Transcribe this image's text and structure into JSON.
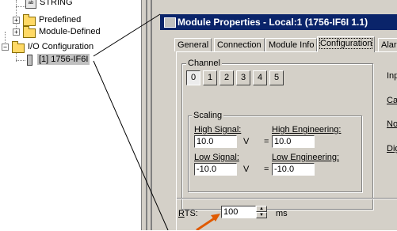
{
  "tree": {
    "items": [
      {
        "label": "STRING",
        "icon": "data-type-icon"
      },
      {
        "label": "Predefined",
        "icon": "data-type-folder-icon",
        "expander": "+"
      },
      {
        "label": "Module-Defined",
        "icon": "data-type-folder-icon",
        "expander": "+"
      },
      {
        "label": "I/O Configuration",
        "icon": "folder-icon",
        "expander": "−"
      },
      {
        "label": "[1] 1756-IF6I",
        "icon": "module-icon"
      }
    ]
  },
  "dialog": {
    "title": "Module Properties - Local:1 (1756-IF6I 1.1)",
    "tabs": [
      "General",
      "Connection",
      "Module Info",
      "Configuration",
      "Alarm"
    ],
    "active_tab": "Configuration",
    "channel": {
      "label": "Channel",
      "buttons": [
        "0",
        "1",
        "2",
        "3",
        "4",
        "5"
      ],
      "selected": "0"
    },
    "scaling": {
      "label": "Scaling",
      "high_signal_label": "High Signal:",
      "high_signal_value": "10.0",
      "high_signal_unit": "V",
      "high_eng_label": "High Engineering:",
      "high_eng_value": "10.0",
      "low_signal_label": "Low Signal:",
      "low_signal_value": "-10.0",
      "low_signal_unit": "V",
      "low_eng_label": "Low Engineering:",
      "low_eng_value": "-10.0",
      "equals": "="
    },
    "right_labels": [
      "Inp",
      "Ca",
      "No",
      "Dig"
    ],
    "rts": {
      "label": "RTS:",
      "value": "100",
      "unit": "ms"
    }
  },
  "colors": {
    "title_bar": "#0a246a",
    "window": "#d4d0c8",
    "arrow": "#e05a00"
  }
}
